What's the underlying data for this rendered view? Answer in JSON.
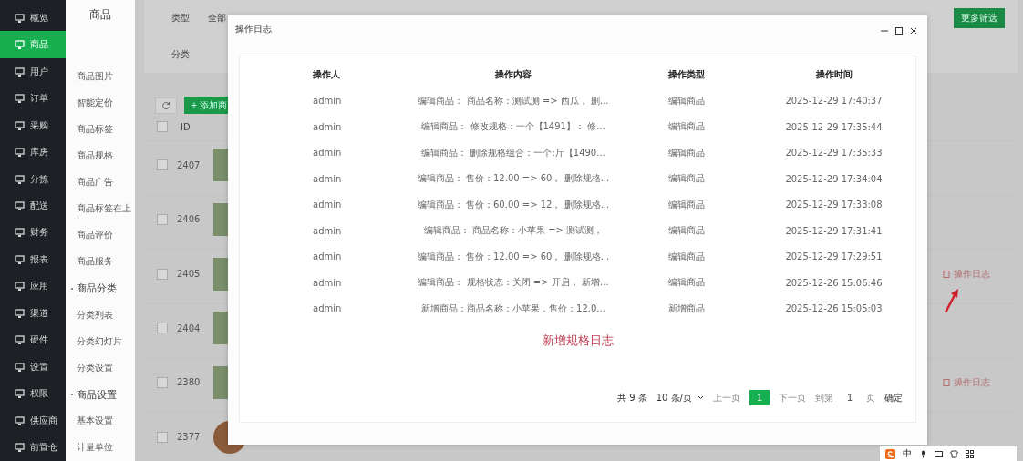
{
  "nav": {
    "items": [
      {
        "label": "概览",
        "selected": false
      },
      {
        "label": "商品",
        "selected": true
      },
      {
        "label": "用户",
        "selected": false
      },
      {
        "label": "订单",
        "selected": false
      },
      {
        "label": "采购",
        "selected": false
      },
      {
        "label": "库房",
        "selected": false
      },
      {
        "label": "分拣",
        "selected": false
      },
      {
        "label": "配送",
        "selected": false
      },
      {
        "label": "财务",
        "selected": false
      },
      {
        "label": "报表",
        "selected": false
      },
      {
        "label": "应用",
        "selected": false
      },
      {
        "label": "渠道",
        "selected": false
      },
      {
        "label": "硬件",
        "selected": false
      },
      {
        "label": "设置",
        "selected": false
      },
      {
        "label": "权限",
        "selected": false
      },
      {
        "label": "供应商",
        "selected": false
      },
      {
        "label": "前置仓",
        "selected": false
      }
    ]
  },
  "subnav": {
    "title": "商品",
    "items": [
      {
        "kind": "link",
        "label": "商品图片"
      },
      {
        "kind": "link",
        "label": "智能定价"
      },
      {
        "kind": "link",
        "label": "商品标签"
      },
      {
        "kind": "link",
        "label": "商品规格"
      },
      {
        "kind": "link",
        "label": "商品广告"
      },
      {
        "kind": "link",
        "label": "商品标签在上"
      },
      {
        "kind": "link",
        "label": "商品评价"
      },
      {
        "kind": "link",
        "label": "商品服务"
      },
      {
        "kind": "group",
        "label": "商品分类"
      },
      {
        "kind": "link",
        "label": "分类列表"
      },
      {
        "kind": "link",
        "label": "分类幻灯片"
      },
      {
        "kind": "link",
        "label": "分类设置"
      },
      {
        "kind": "group",
        "label": "商品设置"
      },
      {
        "kind": "link",
        "label": "基本设置"
      },
      {
        "kind": "link",
        "label": "计量单位"
      }
    ]
  },
  "filters": {
    "type_label": "类型",
    "type_value": "全部",
    "category_label": "分类",
    "more_button": "更多筛选"
  },
  "toolbar": {
    "add_button": "+ 添加商"
  },
  "list": {
    "id_header": "ID",
    "select_all_checked": false,
    "rows": [
      {
        "id": "2407",
        "kind": "photo",
        "checked": false
      },
      {
        "id": "2406",
        "kind": "photo",
        "checked": false
      },
      {
        "id": "2405",
        "kind": "photo",
        "checked": false,
        "log_link": "操作日志"
      },
      {
        "id": "2404",
        "kind": "photo",
        "checked": false
      },
      {
        "id": "2380",
        "kind": "photo",
        "checked": false,
        "log_link": "操作日志"
      },
      {
        "id": "2377",
        "kind": "avatar",
        "checked": false
      }
    ]
  },
  "dialog": {
    "title": "操作日志",
    "columns": [
      "操作人",
      "操作内容",
      "操作类型",
      "操作时间"
    ],
    "rows": [
      [
        "admin",
        "编辑商品： 商品名称：测试测 => 西瓜， 删...",
        "编辑商品",
        "2025-12-29 17:40:37"
      ],
      [
        "admin",
        "编辑商品： 修改规格：一个【1491】： 修...",
        "编辑商品",
        "2025-12-29 17:35:44"
      ],
      [
        "admin",
        "编辑商品： 删除规格组合：一个:斤【1490...",
        "编辑商品",
        "2025-12-29 17:35:33"
      ],
      [
        "admin",
        "编辑商品： 售价：12.00 => 60， 删除规格...",
        "编辑商品",
        "2025-12-29 17:34:04"
      ],
      [
        "admin",
        "编辑商品： 售价：60.00 => 12， 删除规格...",
        "编辑商品",
        "2025-12-29 17:33:08"
      ],
      [
        "admin",
        "编辑商品： 商品名称：小苹果 => 测试测，",
        "编辑商品",
        "2025-12-29 17:31:41"
      ],
      [
        "admin",
        "编辑商品： 售价：12.00 => 60， 删除规格...",
        "编辑商品",
        "2025-12-29 17:29:51"
      ],
      [
        "admin",
        "编辑商品： 规格状态：关闭 => 开启， 新增...",
        "编辑商品",
        "2025-12-26 15:06:46"
      ],
      [
        "admin",
        "新增商品：商品名称：小苹果，售价：12.0...",
        "新增商品",
        "2025-12-26 15:05:03"
      ]
    ],
    "annotation": "新增规格日志",
    "pagination": {
      "total": "共 9 条",
      "page_size": "10 条/页",
      "prev": "上一页",
      "pages": [
        {
          "label": "1",
          "selected": true
        }
      ],
      "next": "下一页",
      "goto_label": "到第",
      "goto_value": "1",
      "page_unit": "页",
      "confirm": "确定"
    }
  },
  "ime_bar": {
    "mode": "中"
  }
}
